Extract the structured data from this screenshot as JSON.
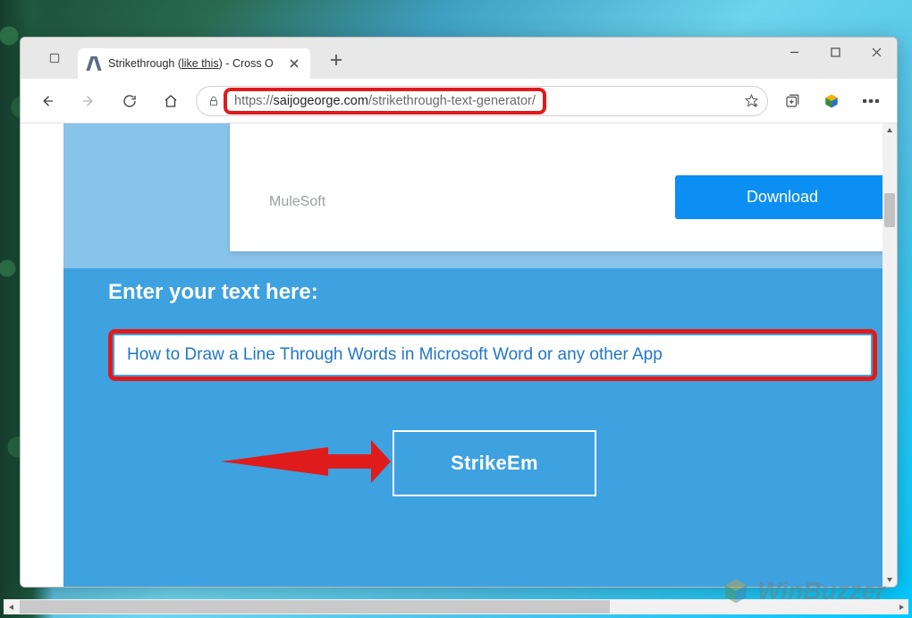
{
  "tab": {
    "title_prefix": "Strikethrough (",
    "title_underline": "like this",
    "title_suffix": ") - Cross O"
  },
  "url": {
    "scheme": "https://",
    "host": "saijogeorge.com",
    "path": "/strikethrough-text-generator/"
  },
  "ad": {
    "brand": "MuleSoft",
    "cta": "Download"
  },
  "page": {
    "enter_label": "Enter your text here:",
    "input_value": "How to Draw a Line Through Words in Microsoft Word or any other App",
    "button_label": "StrikeEm"
  },
  "watermark": {
    "text": "WinBuzzer"
  }
}
